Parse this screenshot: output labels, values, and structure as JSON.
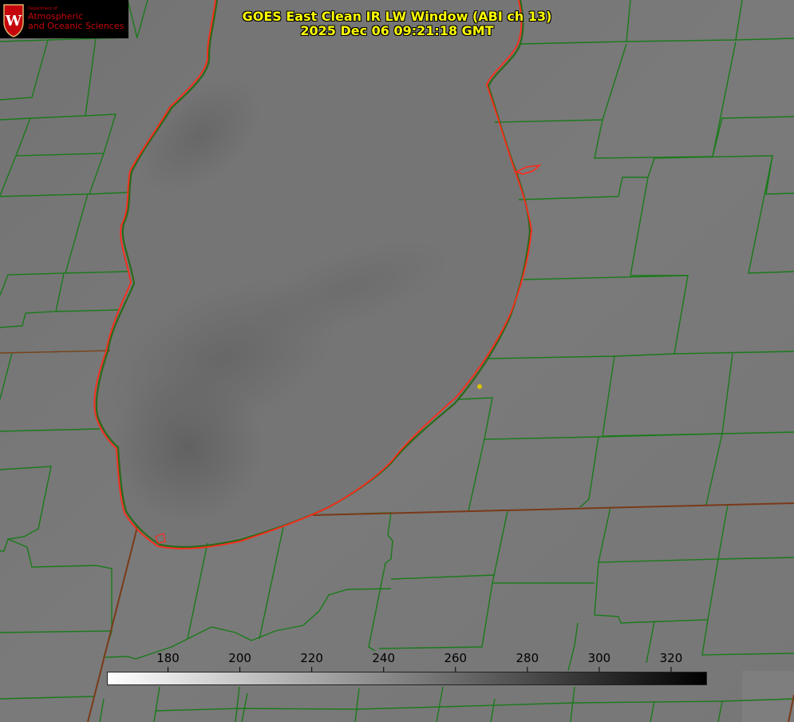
{
  "title": {
    "line1": "GOES East Clean IR LW Window (ABI ch 13)",
    "line2": "2025 Dec 06 09:21:18 GMT"
  },
  "logo": {
    "department": "Department of",
    "line1": "Atmospheric",
    "line2": "and Oceanic Sciences",
    "icon": "university-crest-icon"
  },
  "colorbar": {
    "units_label": "",
    "min": 163,
    "max": 330,
    "ticks": [
      "180",
      "200",
      "220",
      "240",
      "260",
      "280",
      "300",
      "320"
    ],
    "tick_values": [
      180,
      200,
      220,
      240,
      260,
      280,
      300,
      320
    ],
    "colors": {
      "start": "#ffffff",
      "end": "#000000"
    }
  },
  "colors": {
    "background": "#767676",
    "county_lines": "#1a7a1a",
    "lake_outline": "#ff2a1a",
    "marker": "#d8c400",
    "title_text": "#ffff00"
  },
  "map": {
    "feature": "lake-outline",
    "marker": "station-dot"
  }
}
